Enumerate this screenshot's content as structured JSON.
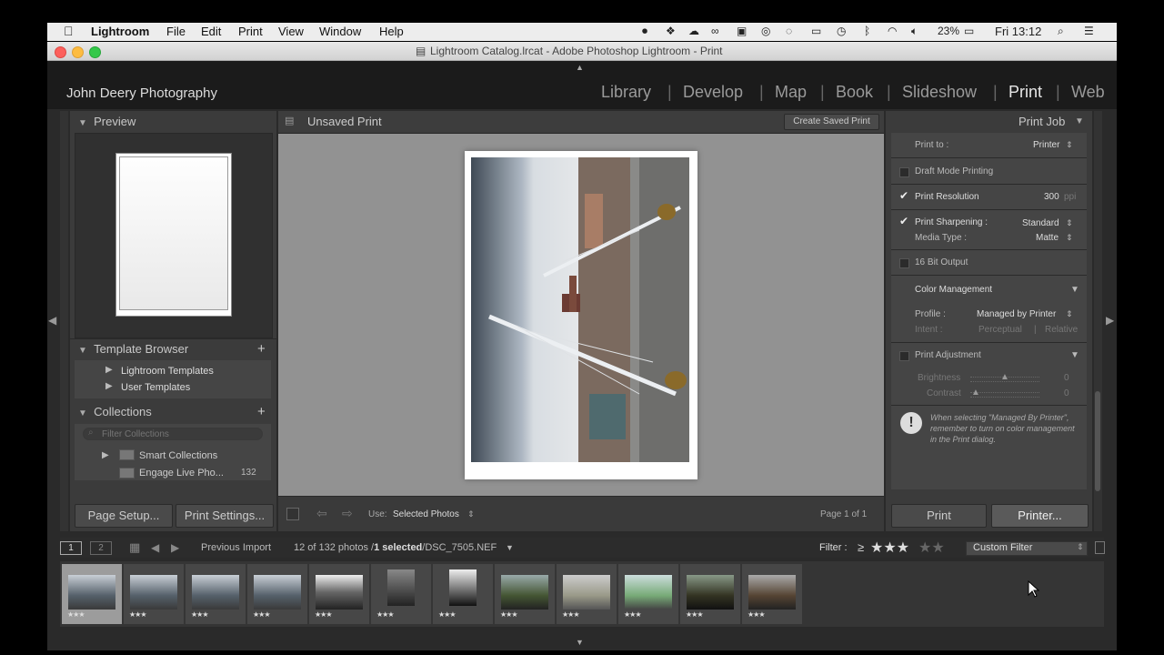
{
  "menubar": {
    "app": "Lightroom",
    "items": [
      "File",
      "Edit",
      "Print",
      "View",
      "Window",
      "Help"
    ],
    "battery": "23%",
    "clock": "Fri 13:12"
  },
  "window": {
    "title": "Lightroom Catalog.lrcat - Adobe Photoshop Lightroom - Print"
  },
  "identity_plate": "John Deery Photography",
  "modules": [
    "Library",
    "Develop",
    "Map",
    "Book",
    "Slideshow",
    "Print",
    "Web"
  ],
  "active_module": "Print",
  "left_panel": {
    "preview_title": "Preview",
    "template_browser_title": "Template Browser",
    "templates": [
      "Lightroom Templates",
      "User Templates"
    ],
    "collections_title": "Collections",
    "filter_placeholder": "Filter Collections",
    "collections": [
      {
        "label": "Smart Collections",
        "count": ""
      },
      {
        "label": "Engage Live Pho...",
        "count": "132"
      }
    ],
    "page_setup": "Page Setup...",
    "print_settings": "Print Settings..."
  },
  "center": {
    "title": "Unsaved Print",
    "create_saved_print": "Create Saved Print",
    "use_label": "Use:",
    "use_value": "Selected Photos",
    "page_indicator": "Page 1 of 1"
  },
  "right_panel": {
    "title": "Print Job",
    "print_to_label": "Print to :",
    "print_to_value": "Printer",
    "draft_mode": "Draft Mode Printing",
    "print_resolution": "Print Resolution",
    "resolution_value": "300",
    "resolution_unit": "ppi",
    "print_sharpening": "Print Sharpening :",
    "sharpening_value": "Standard",
    "media_type_label": "Media Type :",
    "media_type_value": "Matte",
    "bit_output": "16 Bit Output",
    "color_management": "Color Management",
    "profile_label": "Profile :",
    "profile_value": "Managed by Printer",
    "intent_label": "Intent :",
    "intent_perceptual": "Perceptual",
    "intent_relative": "Relative",
    "print_adjustment": "Print Adjustment",
    "brightness_label": "Brightness",
    "brightness_value": "0",
    "contrast_label": "Contrast",
    "contrast_value": "0",
    "note": "When selecting \"Managed By Printer\", remember to turn on color management in the Print dialog.",
    "print_btn": "Print",
    "printer_btn": "Printer..."
  },
  "filmbar": {
    "monitor1": "1",
    "monitor2": "2",
    "source": "Previous Import",
    "count_prefix": "12 of 132 photos /",
    "selected": "1 selected",
    "filename": "/DSC_7505.NEF",
    "filter_label": "Filter :",
    "filter_op": "≥",
    "filter_stars": "★★★",
    "filter_empty_stars": "★★",
    "custom_filter": "Custom Filter"
  },
  "thumb_stars": "★★★"
}
